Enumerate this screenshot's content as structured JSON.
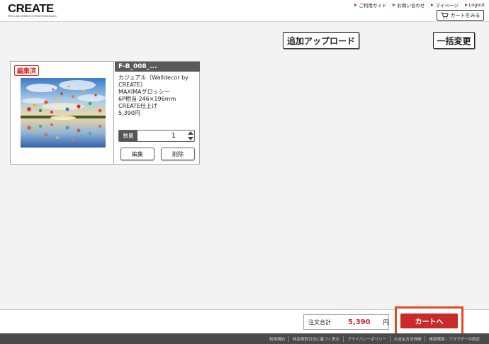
{
  "header": {
    "logo_main": "CREATE",
    "logo_sub": "PRO-LAB CREATIVE PROFESSIONALS",
    "links": [
      {
        "label": "ご利用ガイド"
      },
      {
        "label": "お問い合わせ"
      },
      {
        "label": "マイページ"
      },
      {
        "label": "Logout"
      }
    ],
    "cart_view_label": "カートをみる"
  },
  "toolbar": {
    "add_upload_label": "追加アップロード",
    "bulk_change_label": "一括変更"
  },
  "item": {
    "badge": "編集済",
    "title": "F-B_008_...",
    "description": [
      "カジュアル（Walldecor by",
      "CREATE）",
      "MAXIMAグロッシー",
      "6P相当 246×196mm",
      "CREATE仕上げ",
      "5,390円"
    ],
    "quantity_label": "数量",
    "quantity": "1",
    "edit_label": "編集",
    "delete_label": "削除"
  },
  "summary": {
    "total_label": "注文合計",
    "total_value": "5,390",
    "total_unit": "円",
    "checkout_label": "カートへ"
  },
  "footer": {
    "links": [
      "利用規約",
      "特定商取引法に基づく表示",
      "プライバシーポリシー",
      "お支払方法詳細",
      "推奨環境・ブラウザーの設定"
    ]
  },
  "colors": {
    "accent_red": "#c92a2a",
    "highlight_orange": "#e84a1c",
    "footer_bg": "#4a4a4a"
  }
}
